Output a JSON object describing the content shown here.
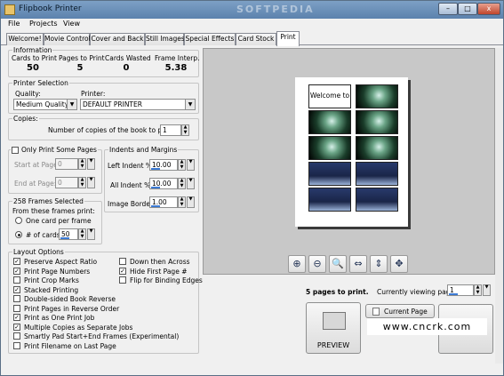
{
  "window": {
    "title": "Flipbook Printer",
    "watermark": "SOFTPEDIA",
    "minimize": "–",
    "maximize": "□",
    "close": "x"
  },
  "menu": {
    "items": [
      "File",
      "Projects",
      "View"
    ]
  },
  "tabs": [
    "Welcome!",
    "Movie Control",
    "Cover and Back",
    "Still Images",
    "Special Effects",
    "Card Stock",
    "Print"
  ],
  "information": {
    "caption": "Information",
    "labels": [
      "Cards to Print",
      "Pages to Print",
      "Cards Wasted",
      "Frame Interp."
    ],
    "values": [
      "50",
      "5",
      "0",
      "5.38"
    ]
  },
  "printer": {
    "caption": "Printer Selection",
    "quality_label": "Quality:",
    "quality_value": "Medium Quality",
    "printer_label": "Printer:",
    "printer_value": "DEFAULT PRINTER"
  },
  "copies": {
    "caption": "Copies:",
    "label": "Number of copies of the book to print:",
    "value": "1"
  },
  "some_pages": {
    "caption": "Only Print Some Pages",
    "start_label": "Start at Page:",
    "start_value": "0",
    "end_label": "End at Page:",
    "end_value": "0"
  },
  "indents": {
    "caption": "Indents and Margins",
    "left_label": "Left Indent %:",
    "left_value": "10.00",
    "all_label": "All Indent %:",
    "all_value": "10.00",
    "border_label": "Image Border:",
    "border_value": "1.00"
  },
  "frames": {
    "caption": "258 Frames Selected",
    "subtitle": "From these frames print:",
    "option1": "One card per frame",
    "option2": "# of cards:",
    "cards_value": "50"
  },
  "layout": {
    "caption": "Layout Options",
    "left_options": [
      {
        "label": "Preserve Aspect Ratio",
        "checked": true
      },
      {
        "label": "Print Page Numbers",
        "checked": true
      },
      {
        "label": "Print Crop Marks",
        "checked": false
      },
      {
        "label": "Stacked Printing",
        "checked": true
      },
      {
        "label": "Double-sided Book Reverse",
        "checked": false
      },
      {
        "label": "Print Pages in Reverse Order",
        "checked": false
      },
      {
        "label": "Print as One Print Job",
        "checked": true
      },
      {
        "label": "Multiple Copies as Separate Jobs",
        "checked": true
      },
      {
        "label": "Smartly Pad Start+End Frames (Experimental)",
        "checked": false
      },
      {
        "label": "Print Filename on Last Page",
        "checked": false
      }
    ],
    "right_options": [
      {
        "label": "Down then Across",
        "checked": false
      },
      {
        "label": "Hide First Page #",
        "checked": true
      },
      {
        "label": "Flip for Binding Edges",
        "checked": false
      }
    ]
  },
  "preview": {
    "welcome_text": "Welcome to",
    "status": "5 pages to print.",
    "viewing_label": "Currently viewing page:",
    "viewing_value": "1",
    "current_page_button": "Current Page",
    "preview_button": "PREVIEW",
    "watermark": "www.cncrk.com"
  }
}
